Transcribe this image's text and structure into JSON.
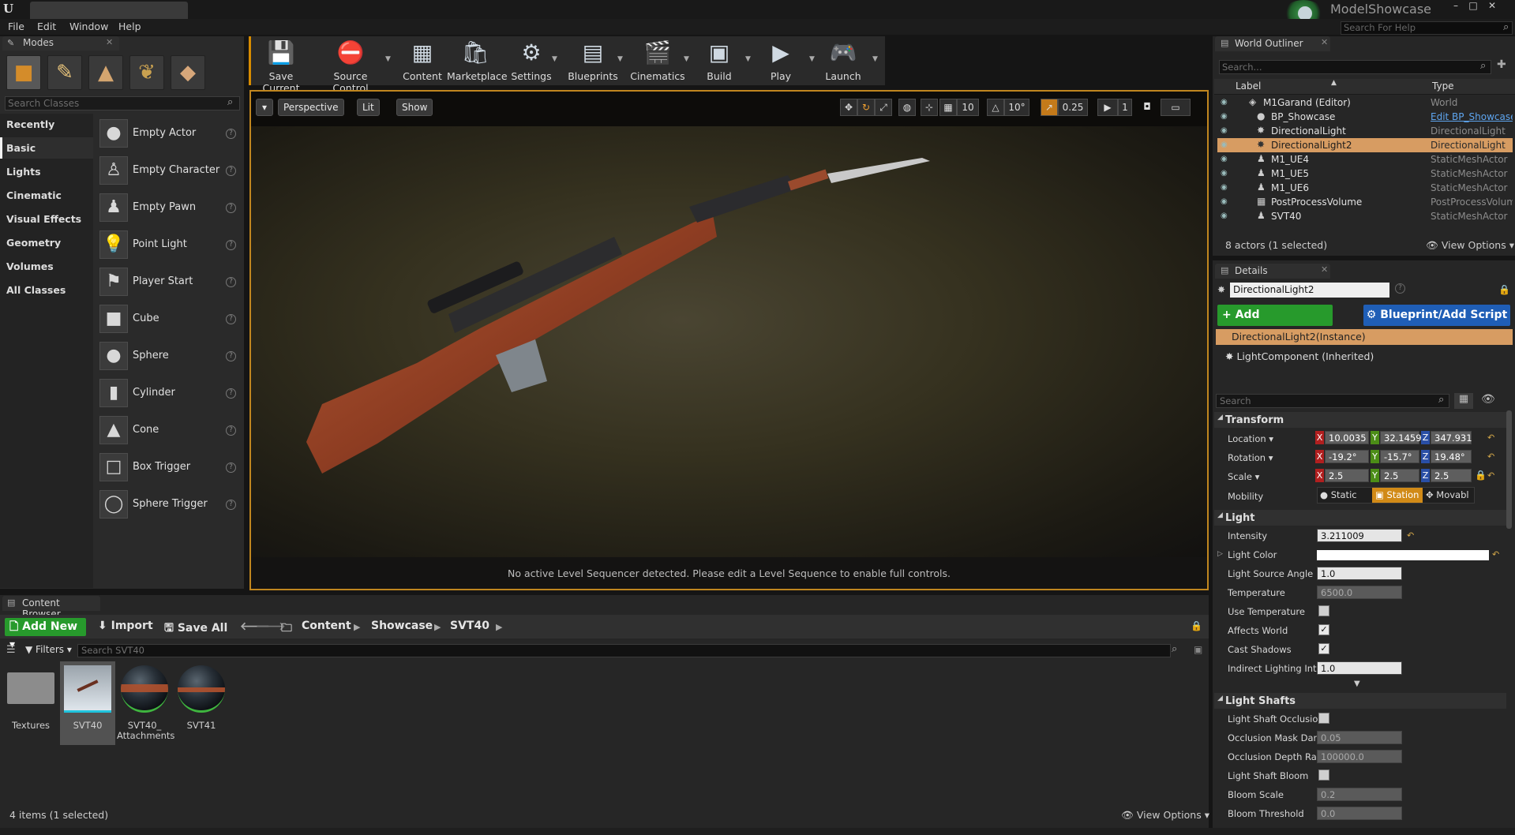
{
  "title_bar": {
    "logo": "U",
    "project": "ModelShowcase",
    "window_controls": [
      "–",
      "□",
      "✕"
    ]
  },
  "menu": [
    "File",
    "Edit",
    "Window",
    "Help"
  ],
  "help_search": {
    "placeholder": "Search For Help"
  },
  "modes": {
    "tab_label": "Modes",
    "search_placeholder": "Search Classes",
    "categories": [
      "Recently Placed",
      "Basic",
      "Lights",
      "Cinematic",
      "Visual Effects",
      "Geometry",
      "Volumes",
      "All Classes"
    ],
    "active_category": "Basic",
    "classes": [
      "Empty Actor",
      "Empty Character",
      "Empty Pawn",
      "Point Light",
      "Player Start",
      "Cube",
      "Sphere",
      "Cylinder",
      "Cone",
      "Box Trigger",
      "Sphere Trigger"
    ]
  },
  "toolbar": [
    "Save Current",
    "Source Control",
    "Content",
    "Marketplace",
    "Settings",
    "Blueprints",
    "Cinematics",
    "Build",
    "Play",
    "Launch"
  ],
  "viewport": {
    "perspective": "Perspective",
    "lit": "Lit",
    "show": "Show",
    "grid_snap": "10",
    "rot_snap": "10°",
    "scale_snap": "0.25",
    "camera_speed": "1",
    "sequencer_msg": "No active Level Sequencer detected. Please edit a Level Sequence to enable full controls."
  },
  "outliner": {
    "tab_label": "World Outliner",
    "search_placeholder": "Search...",
    "col_label": "Label",
    "col_type": "Type",
    "rows": [
      {
        "label": "M1Garand (Editor)",
        "type": "World"
      },
      {
        "label": "BP_Showcase",
        "type": "Edit BP_Showcase"
      },
      {
        "label": "DirectionalLight",
        "type": "DirectionalLight"
      },
      {
        "label": "DirectionalLight2",
        "type": "DirectionalLight"
      },
      {
        "label": "M1_UE4",
        "type": "StaticMeshActor"
      },
      {
        "label": "M1_UE5",
        "type": "StaticMeshActor"
      },
      {
        "label": "M1_UE6",
        "type": "StaticMeshActor"
      },
      {
        "label": "PostProcessVolume",
        "type": "PostProcessVolum"
      },
      {
        "label": "SVT40",
        "type": "StaticMeshActor"
      }
    ],
    "selected": "DirectionalLight2",
    "count": "8 actors (1 selected)",
    "view_options": "View Options"
  },
  "details": {
    "tab_label": "Details",
    "name": "DirectionalLight2",
    "add_component": "+ Add Component",
    "blueprint_script": "Blueprint/Add Script",
    "instance": "DirectionalLight2(Instance)",
    "inherited": "LightComponent (Inherited)",
    "search_placeholder": "Search",
    "transform": {
      "section": "Transform",
      "location_label": "Location",
      "location": [
        "10.0035",
        "32.1459",
        "347.931"
      ],
      "rotation_label": "Rotation",
      "rotation": [
        "-19.2°",
        "-15.7°",
        "19.48°"
      ],
      "scale_label": "Scale",
      "scale": [
        "2.5",
        "2.5",
        "2.5"
      ],
      "mobility_label": "Mobility",
      "mobility": [
        "Static",
        "Station",
        "Movabl"
      ],
      "mobility_selected": "Station"
    },
    "light": {
      "section": "Light",
      "intensity_label": "Intensity",
      "intensity": "3.211009",
      "color_label": "Light Color",
      "angle_label": "Light Source Angle",
      "angle": "1.0",
      "temp_label": "Temperature",
      "temp": "6500.0",
      "use_temp_label": "Use Temperature",
      "use_temp": false,
      "affects_label": "Affects World",
      "affects": true,
      "shadows_label": "Cast Shadows",
      "shadows": true,
      "indirect_label": "Indirect Lighting Inten",
      "indirect": "1.0"
    },
    "shafts": {
      "section": "Light Shafts",
      "occlusion_label": "Light Shaft Occlusion",
      "mask_label": "Occlusion Mask Darkı",
      "mask": "0.05",
      "depth_label": "Occlusion Depth Rang",
      "depth": "100000.0",
      "bloom_label": "Light Shaft Bloom",
      "bloom_scale_label": "Bloom Scale",
      "bloom_scale": "0.2",
      "bloom_thresh_label": "Bloom Threshold",
      "bloom_thresh": "0.0"
    }
  },
  "content_browser": {
    "tab_label": "Content Browser",
    "add_new": "Add New",
    "import": "Import",
    "save_all": "Save All",
    "path": [
      "Content",
      "Showcase",
      "SVT40"
    ],
    "filters": "Filters",
    "search_placeholder": "Search SVT40",
    "assets": [
      "Textures",
      "SVT40",
      "SVT40_ Attachments",
      "SVT41"
    ],
    "count": "4 items (1 selected)",
    "view_options": "View Options"
  }
}
